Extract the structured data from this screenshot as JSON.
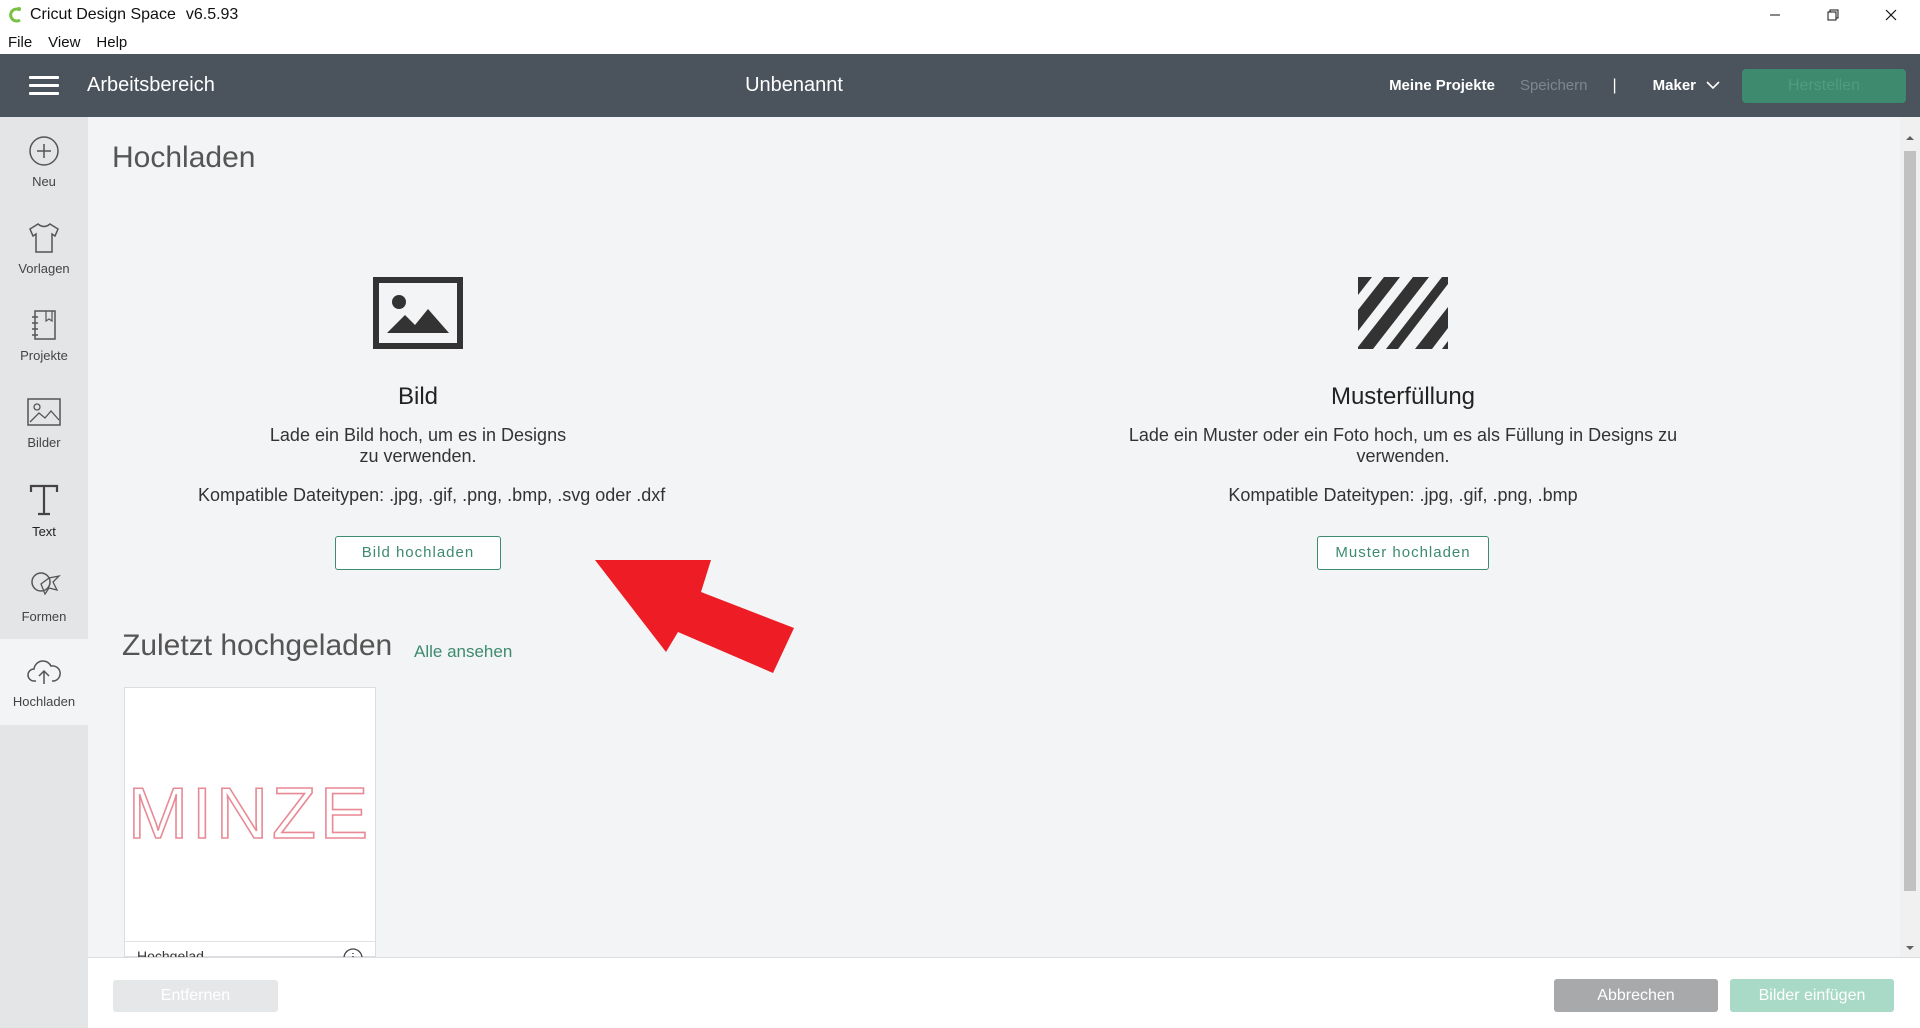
{
  "window": {
    "app_title": "Cricut Design Space",
    "version": "v6.5.93",
    "controls": [
      "minimize",
      "restore",
      "close"
    ]
  },
  "menu": {
    "items": [
      {
        "label": "File"
      },
      {
        "label": "View"
      },
      {
        "label": "Help"
      }
    ]
  },
  "header": {
    "workspace": "Arbeitsbereich",
    "document_title": "Unbenannt",
    "my_projects": "Meine Projekte",
    "save": "Speichern",
    "separator": "|",
    "machine": "Maker",
    "make": "Herstellen"
  },
  "sidebar": {
    "items": [
      {
        "label": "Neu",
        "icon": "plus-circle-icon"
      },
      {
        "label": "Vorlagen",
        "icon": "tshirt-icon"
      },
      {
        "label": "Projekte",
        "icon": "notebook-icon"
      },
      {
        "label": "Bilder",
        "icon": "image-icon"
      },
      {
        "label": "Text",
        "icon": "text-icon"
      },
      {
        "label": "Formen",
        "icon": "shapes-icon"
      },
      {
        "label": "Hochladen",
        "icon": "cloud-upload-icon",
        "active": true
      }
    ]
  },
  "main": {
    "title": "Hochladen",
    "image_upload": {
      "heading": "Bild",
      "description": "Lade ein Bild hoch, um es in Designs zu verwenden.",
      "file_types": "Kompatible Dateitypen: .jpg, .gif, .png, .bmp, .svg oder .dxf",
      "button": "Bild hochladen"
    },
    "pattern_upload": {
      "heading": "Musterfüllung",
      "description": "Lade ein Muster oder ein Foto hoch, um es als Füllung in Designs zu verwenden.",
      "file_types": "Kompatible Dateitypen: .jpg, .gif, .png, .bmp",
      "button": "Muster hochladen"
    },
    "recent": {
      "title": "Zuletzt hochgeladen",
      "see_all": "Alle ansehen",
      "items": [
        {
          "preview_text": "MINZE",
          "label": "Hochgelad..."
        }
      ]
    }
  },
  "footer": {
    "remove": "Entfernen",
    "cancel": "Abbrechen",
    "insert": "Bilder einfügen"
  },
  "colors": {
    "header_bg": "#4b545c",
    "accent_green": "#3d8a6e",
    "arrow_red": "#ee1c25"
  }
}
